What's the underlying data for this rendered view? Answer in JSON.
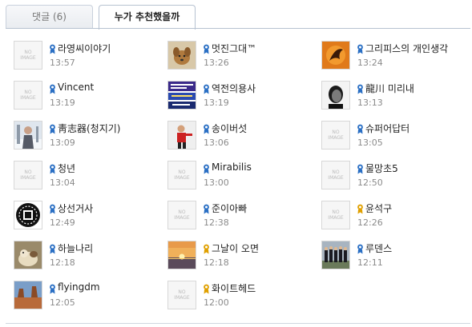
{
  "tabs": {
    "comments": "댓글 (6)",
    "recommenders": "누가 추천했을까"
  },
  "placeholder": {
    "line1": "NO",
    "line2": "IMAGE"
  },
  "colors": {
    "badge_blue": "#2a6fc4",
    "badge_gold": "#e0a000",
    "tab_border": "#b7c2d1"
  },
  "users": [
    {
      "name": "라영씨이야기",
      "time": "13:57",
      "avatar": "none",
      "badge": "blue"
    },
    {
      "name": "멋진그대™",
      "time": "13:26",
      "avatar": "dog-photo",
      "badge": "blue"
    },
    {
      "name": "그리피스의 개인생각",
      "time": "13:24",
      "avatar": "orange-emblem",
      "badge": "blue"
    },
    {
      "name": "Vincent",
      "time": "13:19",
      "avatar": "none",
      "badge": "blue"
    },
    {
      "name": "역전의용사",
      "time": "13:19",
      "avatar": "blue-text-banner",
      "badge": "blue"
    },
    {
      "name": "龍川 미리내",
      "time": "13:13",
      "avatar": "bw-portrait",
      "badge": "blue"
    },
    {
      "name": "靑志器(청지기)",
      "time": "13:09",
      "avatar": "snow-person",
      "badge": "blue"
    },
    {
      "name": "송이버섯",
      "time": "13:06",
      "avatar": "red-figure",
      "badge": "blue"
    },
    {
      "name": "슈퍼어답터",
      "time": "13:05",
      "avatar": "none",
      "badge": "blue"
    },
    {
      "name": "청년",
      "time": "13:04",
      "avatar": "none",
      "badge": "blue"
    },
    {
      "name": "Mirabilis",
      "time": "13:00",
      "avatar": "none",
      "badge": "blue"
    },
    {
      "name": "물망초5",
      "time": "12:50",
      "avatar": "none",
      "badge": "blue"
    },
    {
      "name": "상선거사",
      "time": "12:49",
      "avatar": "black-seal",
      "badge": "blue"
    },
    {
      "name": "준이아빠",
      "time": "12:38",
      "avatar": "none",
      "badge": "blue"
    },
    {
      "name": "윤석구",
      "time": "12:26",
      "avatar": "none",
      "badge": "gold"
    },
    {
      "name": "하늘나리",
      "time": "12:18",
      "avatar": "cat-photo",
      "badge": "blue"
    },
    {
      "name": "그날이 오면",
      "time": "12:18",
      "avatar": "sunset-photo",
      "badge": "gold"
    },
    {
      "name": "루덴스",
      "time": "12:11",
      "avatar": "group-photo",
      "badge": "blue"
    },
    {
      "name": "flyingdm",
      "time": "12:05",
      "avatar": "desert-photo",
      "badge": "blue"
    },
    {
      "name": "화이트헤드",
      "time": "12:00",
      "avatar": "none",
      "badge": "gold"
    }
  ]
}
